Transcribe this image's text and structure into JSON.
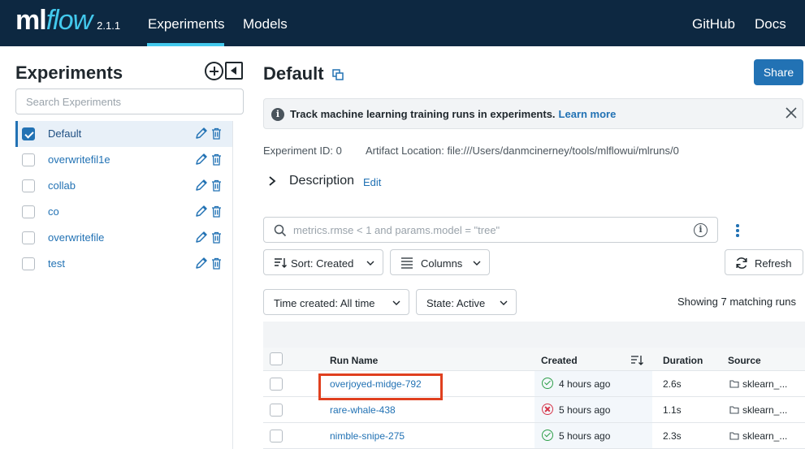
{
  "app": {
    "logo_ml": "ml",
    "logo_flow": "flow",
    "version": "2.1.1",
    "nav": [
      "Experiments",
      "Models"
    ],
    "nav_right": [
      "GitHub",
      "Docs"
    ],
    "colors": {
      "nav_bg": "#0d2841",
      "accent": "#43c9ed",
      "primary": "#2272b4",
      "highlight": "#e0401f"
    }
  },
  "sidebar": {
    "title": "Experiments",
    "search_placeholder": "Search Experiments",
    "items": [
      {
        "name": "Default",
        "checked": true
      },
      {
        "name": "overwritefil1e",
        "checked": false
      },
      {
        "name": "collab",
        "checked": false
      },
      {
        "name": "co",
        "checked": false
      },
      {
        "name": "overwritefile",
        "checked": false
      },
      {
        "name": "test",
        "checked": false
      }
    ]
  },
  "main": {
    "title": "Default",
    "share_label": "Share",
    "banner": {
      "text": "Track machine learning training runs in experiments.",
      "link": "Learn more"
    },
    "experiment_id": "Experiment ID: 0",
    "artifact_location": "Artifact Location: file:///Users/danmcinerney/tools/mlflowui/mlruns/0",
    "description_label": "Description",
    "description_edit": "Edit",
    "search_placeholder": "metrics.rmse < 1 and params.model = \"tree\"",
    "sort_label": "Sort: Created",
    "columns_label": "Columns",
    "refresh_label": "Refresh",
    "time_filter": "Time created: All time",
    "state_filter": "State: Active",
    "showing": "Showing 7 matching runs"
  },
  "table": {
    "headers": [
      "Run Name",
      "Created",
      "Duration",
      "Source"
    ],
    "rows": [
      {
        "name": "overjoyed-midge-792",
        "status": "finished",
        "created": "4 hours ago",
        "duration": "2.6s",
        "source": "sklearn_..."
      },
      {
        "name": "rare-whale-438",
        "status": "failed",
        "created": "5 hours ago",
        "duration": "1.1s",
        "source": "sklearn_..."
      },
      {
        "name": "nimble-snipe-275",
        "status": "finished",
        "created": "5 hours ago",
        "duration": "2.3s",
        "source": "sklearn_..."
      }
    ]
  }
}
